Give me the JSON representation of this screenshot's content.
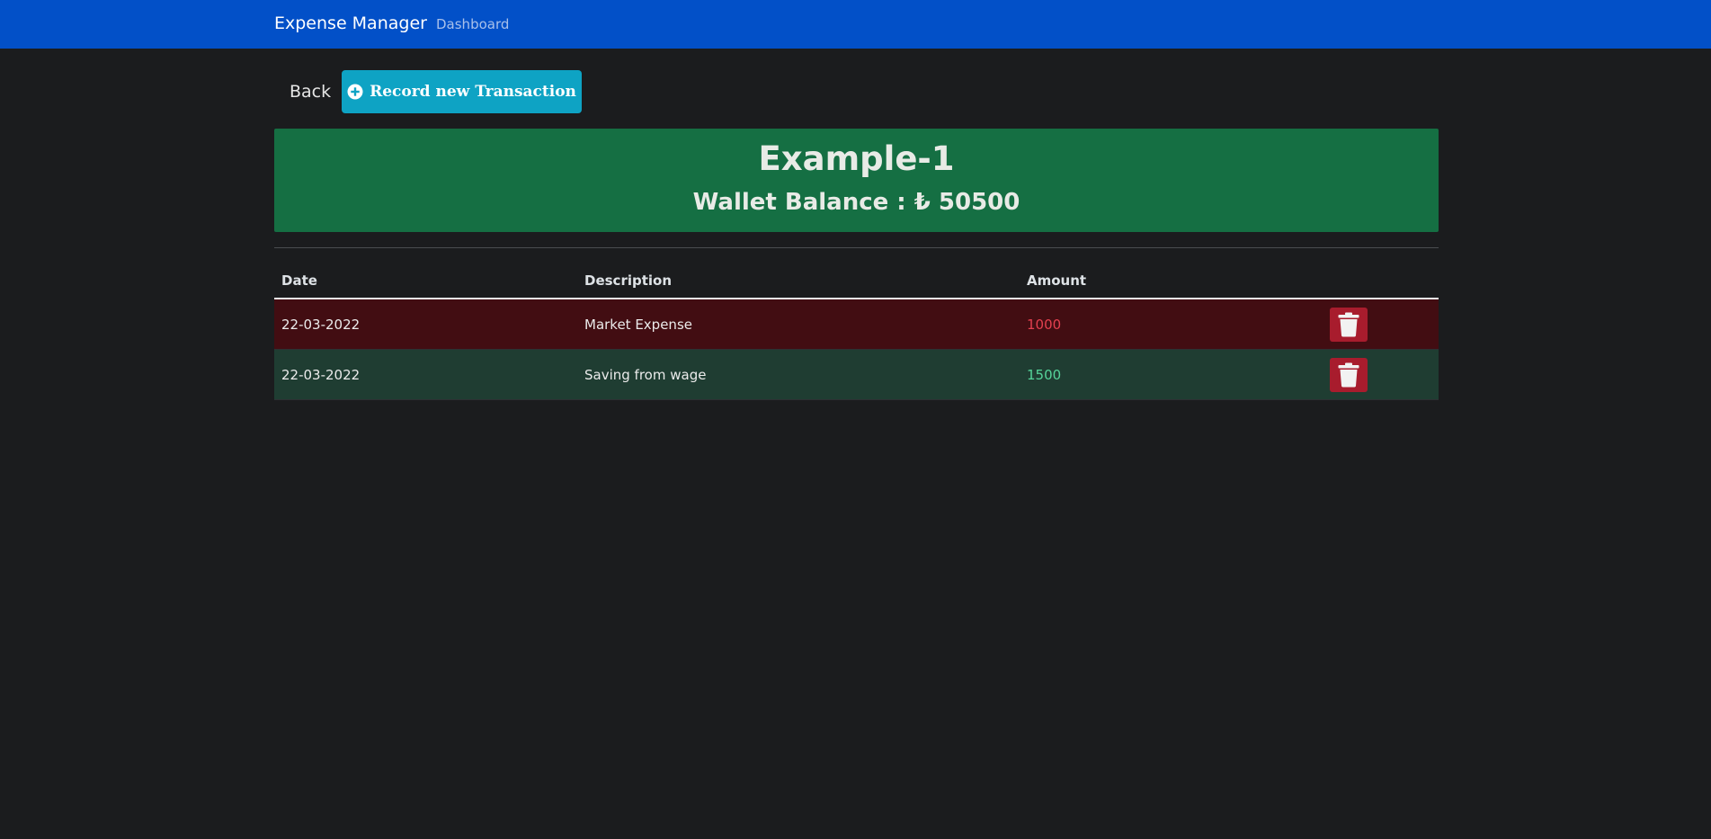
{
  "navbar": {
    "brand": "Expense Manager",
    "links": [
      "Dashboard"
    ]
  },
  "toolbar": {
    "back_label": "Back",
    "record_label": "Record new Transaction",
    "record_icon": "plus-circle-icon"
  },
  "wallet": {
    "title": "Example-1",
    "balance_text": "Wallet Balance : ₺ 50500"
  },
  "table": {
    "headers": [
      "Date",
      "Description",
      "Amount",
      ""
    ],
    "rows": [
      {
        "date": "22-03-2022",
        "description": "Market Expense",
        "amount": "1000",
        "type": "expense",
        "action_icon": "trash-icon"
      },
      {
        "date": "22-03-2022",
        "description": "Saving from wage",
        "amount": "1500",
        "type": "income",
        "action_icon": "trash-icon"
      }
    ]
  },
  "colors": {
    "navbar": "#0250c8",
    "background": "#1b1c1e",
    "banner": "#156f43",
    "record_button": "#0ea3c4",
    "expense_row": "#420d12",
    "income_row": "#1f3d32",
    "expense_amount": "#e4404f",
    "income_amount": "#56d49a",
    "delete_button": "#a81c2d"
  }
}
